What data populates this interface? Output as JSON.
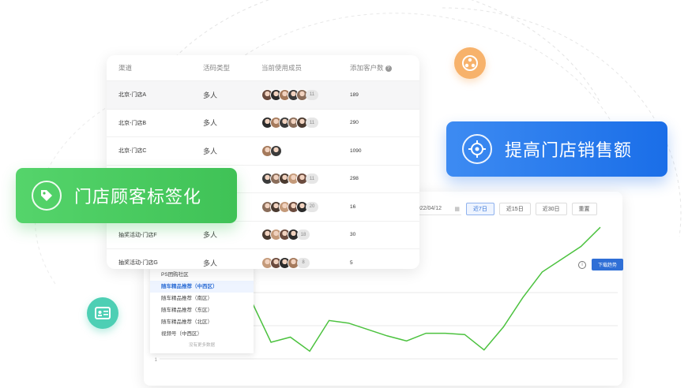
{
  "table": {
    "headers": [
      "渠道",
      "活码类型",
      "当前使用成员",
      "添加客户数"
    ],
    "rows": [
      {
        "channel": "北京-门店A",
        "type": "多人",
        "avatars": 5,
        "members": "11",
        "customers": "189"
      },
      {
        "channel": "北京-门店B",
        "type": "多人",
        "avatars": 5,
        "members": "11",
        "customers": "290"
      },
      {
        "channel": "北京-门店C",
        "type": "多人",
        "avatars": 2,
        "members": "",
        "customers": "1090"
      },
      {
        "channel": "",
        "type": "",
        "avatars": 5,
        "members": "11",
        "customers": "298"
      },
      {
        "channel": "",
        "type": "",
        "avatars": 5,
        "members": "20",
        "customers": "16"
      },
      {
        "channel": "抽奖活动-门店F",
        "type": "多人",
        "avatars": 4,
        "members": "18",
        "customers": "30"
      },
      {
        "channel": "抽奖活动-门店G",
        "type": "多人",
        "avatars": 4,
        "members": "8",
        "customers": "5"
      }
    ]
  },
  "banners": {
    "green": "门店顾客标签化",
    "blue": "提高门店销售额"
  },
  "chart_panel": {
    "end_date": "2022/04/12",
    "btn_7": "近7日",
    "btn_15": "近15日",
    "btn_30": "近30日",
    "reset": "重置",
    "download": "下载趋势",
    "y_tick": "1"
  },
  "dropdown": {
    "items": [
      "PS团购社区",
      "随车精品推荐（中西区）",
      "随车精品推荐（南区）",
      "随车精品推荐（东区）",
      "随车精品推荐（北区）",
      "视频号（中西区）"
    ],
    "selected_index": 1,
    "more": "没有更多数据"
  },
  "chart_data": {
    "type": "line",
    "series": [
      {
        "values": [
          48,
          45,
          13,
          17,
          6,
          30,
          28,
          23,
          18,
          14,
          20,
          20,
          19,
          7,
          25,
          48,
          68,
          78,
          88,
          103
        ]
      }
    ],
    "line_color": "#4cc23f"
  },
  "colors": {
    "green": "#4cc65c",
    "blue": "#2274ec",
    "orange": "#f7b26b",
    "teal": "#4dcfb4"
  }
}
